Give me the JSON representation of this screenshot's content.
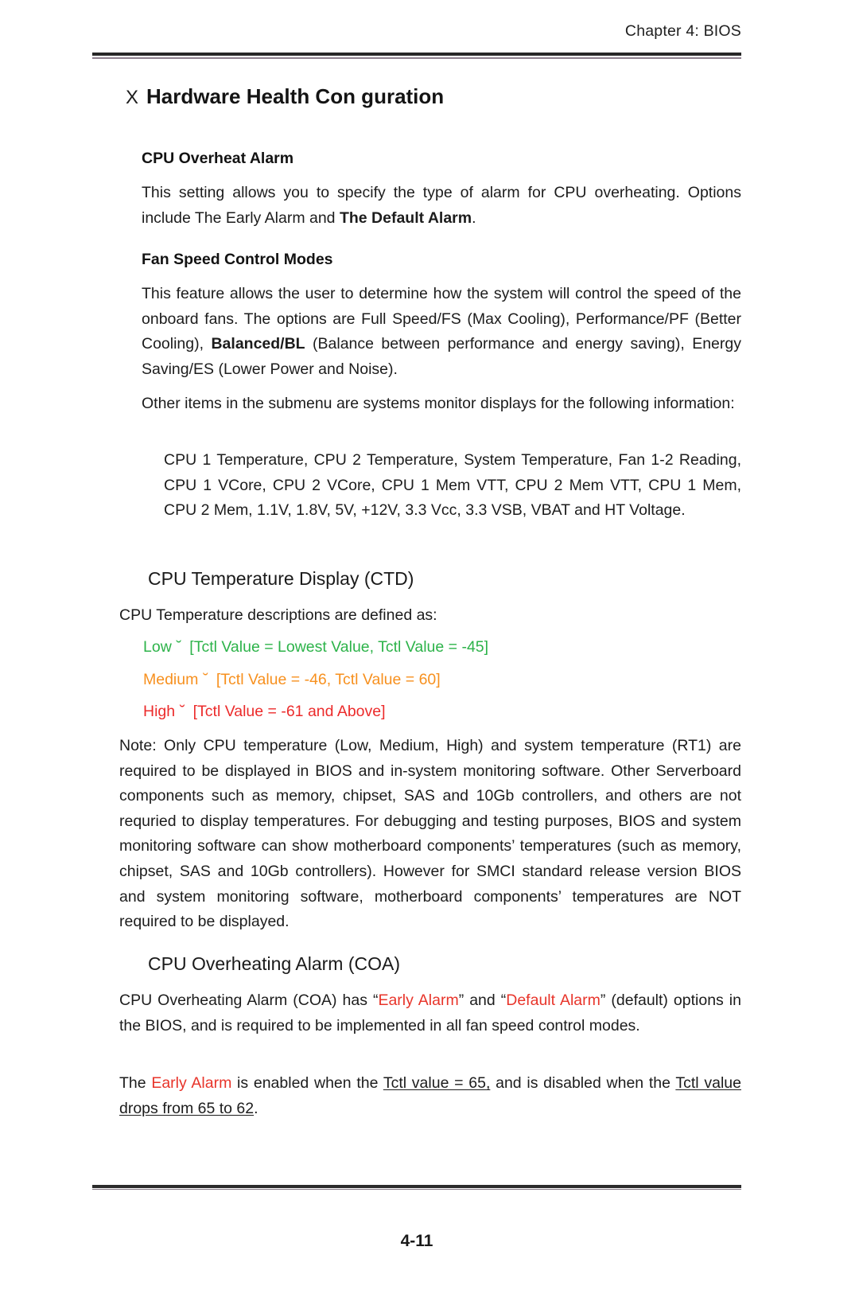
{
  "document": {
    "running_header": "Chapter 4: BIOS",
    "page_number": "4-11"
  },
  "section": {
    "marker_glyph": "X",
    "title": "Hardware Health Con guration"
  },
  "cpu_overheat_alarm": {
    "heading": "CPU Overheat Alarm",
    "para_1_lead": "This setting allows you to specify the type of alarm for CPU overheating. Options include The Early Alarm and ",
    "para_1_bold": "The Default Alarm",
    "para_1_tail": "."
  },
  "fan_speed_control_modes": {
    "heading": "Fan Speed Control Modes",
    "para_1_lead": "This feature allows the user to determine how the system will control the speed of the onboard fans. The options are Full Speed/FS (Max Cooling), Performance/PF (Better Cooling), ",
    "para_1_bold": "Balanced/BL",
    "para_1_tail": " (Balance between performance and energy saving), Energy Saving/ES (Lower Power and Noise).",
    "para_2": "Other items in the submenu are systems monitor displays for the following information:",
    "monitored_items": "CPU 1 Temperature, CPU 2 Temperature, System Temperature, Fan 1-2 Reading, CPU 1 VCore, CPU 2 VCore, CPU 1 Mem VTT, CPU 2 Mem VTT, CPU 1 Mem, CPU 2 Mem, 1.1V, 1.8V, 5V, +12V, 3.3 Vcc, 3.3 VSB, VBAT and HT Voltage."
  },
  "ctd": {
    "heading": "CPU Temperature Display (CTD)",
    "intro": "CPU Temperature descriptions are defined as:",
    "levels": [
      {
        "label": "Low",
        "separator": "˘",
        "range": "[Tctl Value = Lowest Value, Tctl Value = -45]",
        "color": "#2db34a"
      },
      {
        "label": "Medium",
        "separator": "˘",
        "range": "[Tctl Value = -46, Tctl Value = 60]",
        "color": "#f7901e"
      },
      {
        "label": "High",
        "separator": "˘",
        "range": "[Tctl Value = -61 and Above]",
        "color": "#ec2b2b"
      }
    ],
    "note": "Note: Only CPU temperature (Low, Medium, High) and system temperature (RT1) are required to be displayed in BIOS and in-system monitoring software. Other Serverboard components such as memory, chipset, SAS and 10Gb controllers, and others are not requried to display temperatures. For debugging and testing purposes, BIOS and system monitoring software can show motherboard components’ temperatures (such as memory, chipset, SAS and 10Gb controllers). However for SMCI standard release version BIOS and system monitoring software, motherboard components’ temperatures are NOT required to be displayed."
  },
  "coa": {
    "heading": "CPU Overheating Alarm (COA)",
    "para_1_seg_1": "CPU Overheating Alarm (COA) has “",
    "para_1_red_1": "Early Alarm",
    "para_1_seg_2": "” and “",
    "para_1_red_2": "Default Alarm",
    "para_1_seg_3": "” (default) options in the BIOS, and is required to be implemented in all fan speed control modes.",
    "para_2_seg_1": "The ",
    "para_2_red_1": "Early Alarm",
    "para_2_seg_2": " is enabled when the ",
    "para_2_underline_1": "Tctl value = 65,",
    "para_2_seg_3": " and is disabled when the ",
    "para_2_underline_2": "Tctl value drops from 65 to 62",
    "para_2_seg_4": "."
  },
  "colors": {
    "low": "#2db34a",
    "medium": "#f7901e",
    "high": "#ec2b2b",
    "accent_red": "#e8342a",
    "rule_dark": "#262626",
    "rule_light": "#8d7f8d"
  }
}
